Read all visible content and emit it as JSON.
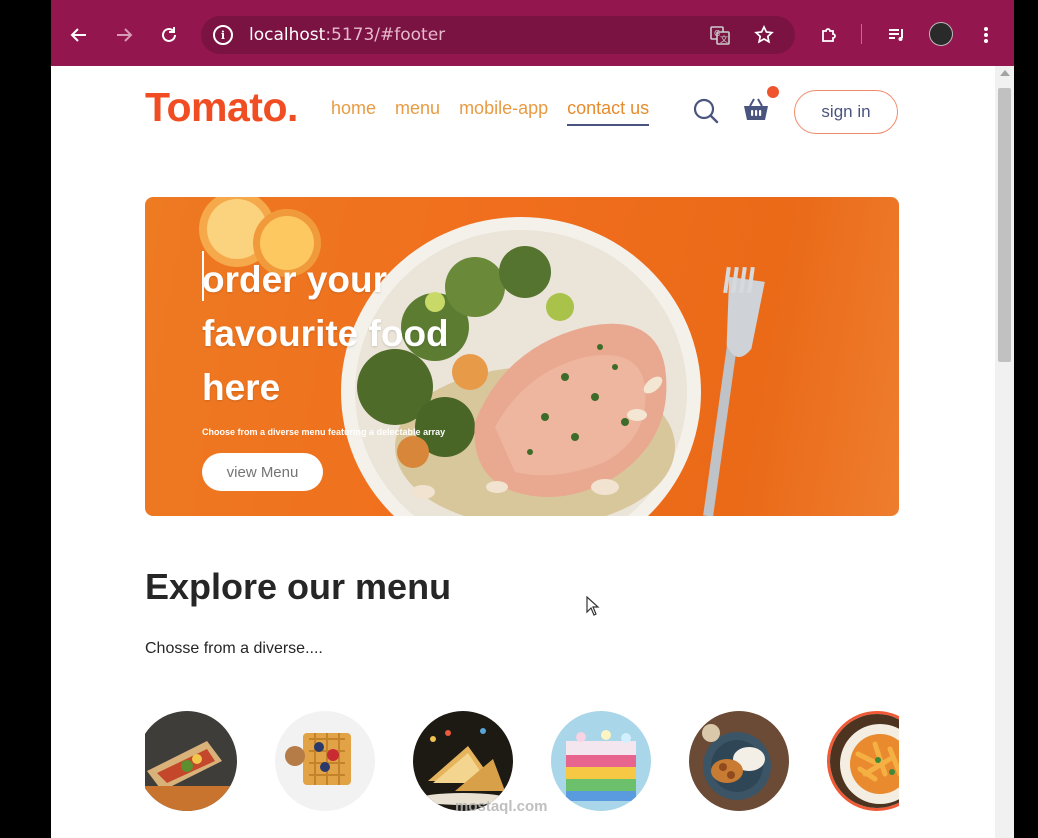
{
  "browser": {
    "url_host": "localhost",
    "url_rest": ":5173/#footer"
  },
  "navbar": {
    "logo": "Tomato.",
    "links": [
      "home",
      "menu",
      "mobile-app",
      "contact us"
    ],
    "active_link": "contact us",
    "sign_in_label": "sign in",
    "cart_has_items": true
  },
  "hero": {
    "title": "order your favourite food here",
    "subtitle": "Choose from a diverse menu featuring a delectable array",
    "button_label": "view Menu"
  },
  "explore": {
    "title": "Explore our menu",
    "subtitle": "Chosse from a diverse....",
    "items": [
      {
        "icon": "rolls-photo"
      },
      {
        "icon": "dessert-waffle-photo"
      },
      {
        "icon": "sandwich-photo"
      },
      {
        "icon": "cake-photo"
      },
      {
        "icon": "pure-veg-photo"
      },
      {
        "icon": "pasta-photo",
        "selected": true
      }
    ]
  },
  "watermark": "mostaql.com",
  "colors": {
    "brand": "#f04d23",
    "browser_frame": "#93174e",
    "menu_link": "#e89b43",
    "hero_bg": "#ee7a22",
    "active_underline": "#49557e"
  }
}
